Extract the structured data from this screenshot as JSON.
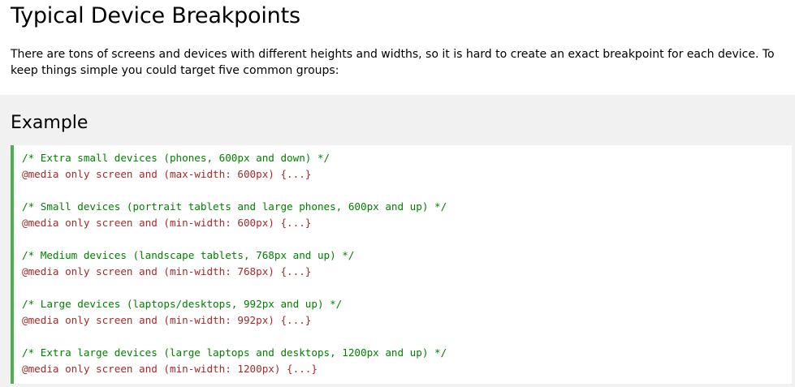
{
  "title": "Typical Device Breakpoints",
  "intro": "There are tons of screens and devices with different heights and widths, so it is hard to create an exact breakpoint for each device. To keep things simple you could target five common groups:",
  "example": {
    "heading": "Example",
    "accent_color": "#4caf50",
    "comment_color": "#008000",
    "rule_color": "#a52a2a",
    "groups": [
      {
        "comment": "/* Extra small devices (phones, 600px and down) */",
        "rule": "@media only screen and (max-width: 600px) {...}"
      },
      {
        "comment": "/* Small devices (portrait tablets and large phones, 600px and up) */",
        "rule": "@media only screen and (min-width: 600px) {...}"
      },
      {
        "comment": "/* Medium devices (landscape tablets, 768px and up) */",
        "rule": "@media only screen and (min-width: 768px) {...}"
      },
      {
        "comment": "/* Large devices (laptops/desktops, 992px and up) */",
        "rule": "@media only screen and (min-width: 992px) {...}"
      },
      {
        "comment": "/* Extra large devices (large laptops and desktops, 1200px and up) */",
        "rule": "@media only screen and (min-width: 1200px) {...}"
      }
    ]
  }
}
